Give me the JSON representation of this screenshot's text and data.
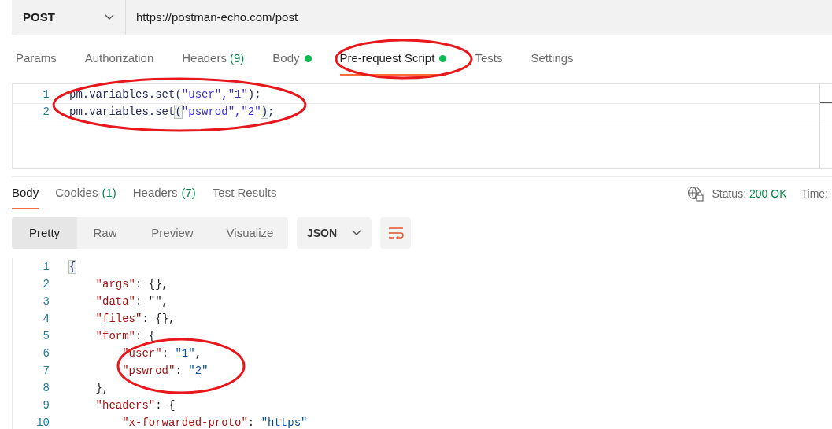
{
  "request": {
    "method": "POST",
    "url": "https://postman-echo.com/post"
  },
  "request_tabs": [
    {
      "label": "Params",
      "selected": false,
      "dot": false
    },
    {
      "label": "Authorization",
      "selected": false,
      "dot": false
    },
    {
      "label": "Headers",
      "count": "(9)",
      "selected": false,
      "dot": false
    },
    {
      "label": "Body",
      "selected": false,
      "dot": true
    },
    {
      "label": "Pre-request Script",
      "selected": true,
      "dot": true
    },
    {
      "label": "Tests",
      "selected": false,
      "dot": false
    },
    {
      "label": "Settings",
      "selected": false,
      "dot": false
    }
  ],
  "script": {
    "lines": [
      {
        "number": "1",
        "tokens": [
          {
            "kind": "ident",
            "text": "pm.variables.set("
          },
          {
            "kind": "string",
            "text": "\"user\",\"1\""
          },
          {
            "kind": "ident",
            "text": ");"
          }
        ]
      },
      {
        "number": "2",
        "tokens": [
          {
            "kind": "ident",
            "text": "pm.variables.set"
          },
          {
            "kind": "bracket",
            "text": "("
          },
          {
            "kind": "string",
            "text": "\"pswrod\",\"2\""
          },
          {
            "kind": "bracket",
            "text": ")"
          },
          {
            "kind": "ident",
            "text": ";"
          }
        ]
      }
    ]
  },
  "response": {
    "tabs": [
      {
        "label": "Body",
        "selected": true
      },
      {
        "label": "Cookies",
        "count": "(1)",
        "selected": false
      },
      {
        "label": "Headers",
        "count": "(7)",
        "selected": false
      },
      {
        "label": "Test Results",
        "selected": false
      }
    ],
    "status_label": "Status:",
    "status_value": "200 OK",
    "time_label": "Time:",
    "view_modes": [
      {
        "label": "Pretty",
        "selected": true
      },
      {
        "label": "Raw",
        "selected": false
      },
      {
        "label": "Preview",
        "selected": false
      },
      {
        "label": "Visualize",
        "selected": false
      }
    ],
    "format": "JSON",
    "body_lines": [
      {
        "number": "1",
        "tokens": [
          {
            "kind": "bracket",
            "text": "{"
          }
        ]
      },
      {
        "number": "2",
        "tokens": [
          {
            "kind": "key",
            "text": "    \"args\""
          },
          {
            "kind": "plain",
            "text": ": {},"
          }
        ]
      },
      {
        "number": "3",
        "tokens": [
          {
            "kind": "key",
            "text": "    \"data\""
          },
          {
            "kind": "plain",
            "text": ": \"\","
          }
        ]
      },
      {
        "number": "4",
        "tokens": [
          {
            "kind": "key",
            "text": "    \"files\""
          },
          {
            "kind": "plain",
            "text": ": {},"
          }
        ]
      },
      {
        "number": "5",
        "tokens": [
          {
            "kind": "key",
            "text": "    \"form\""
          },
          {
            "kind": "plain",
            "text": ": {"
          }
        ]
      },
      {
        "number": "6",
        "tokens": [
          {
            "kind": "key",
            "text": "        \"user\""
          },
          {
            "kind": "plain",
            "text": ": "
          },
          {
            "kind": "value",
            "text": "\"1\""
          },
          {
            "kind": "plain",
            "text": ","
          }
        ]
      },
      {
        "number": "7",
        "tokens": [
          {
            "kind": "key",
            "text": "        \"pswrod\""
          },
          {
            "kind": "plain",
            "text": ": "
          },
          {
            "kind": "value",
            "text": "\"2\""
          }
        ]
      },
      {
        "number": "8",
        "tokens": [
          {
            "kind": "plain",
            "text": "    },"
          }
        ]
      },
      {
        "number": "9",
        "tokens": [
          {
            "kind": "key",
            "text": "    \"headers\""
          },
          {
            "kind": "plain",
            "text": ": {"
          }
        ]
      },
      {
        "number": "10",
        "tokens": [
          {
            "kind": "key",
            "text": "        \"x-forwarded-proto\""
          },
          {
            "kind": "plain",
            "text": ": "
          },
          {
            "kind": "value",
            "text": "\"https\""
          }
        ]
      }
    ]
  }
}
